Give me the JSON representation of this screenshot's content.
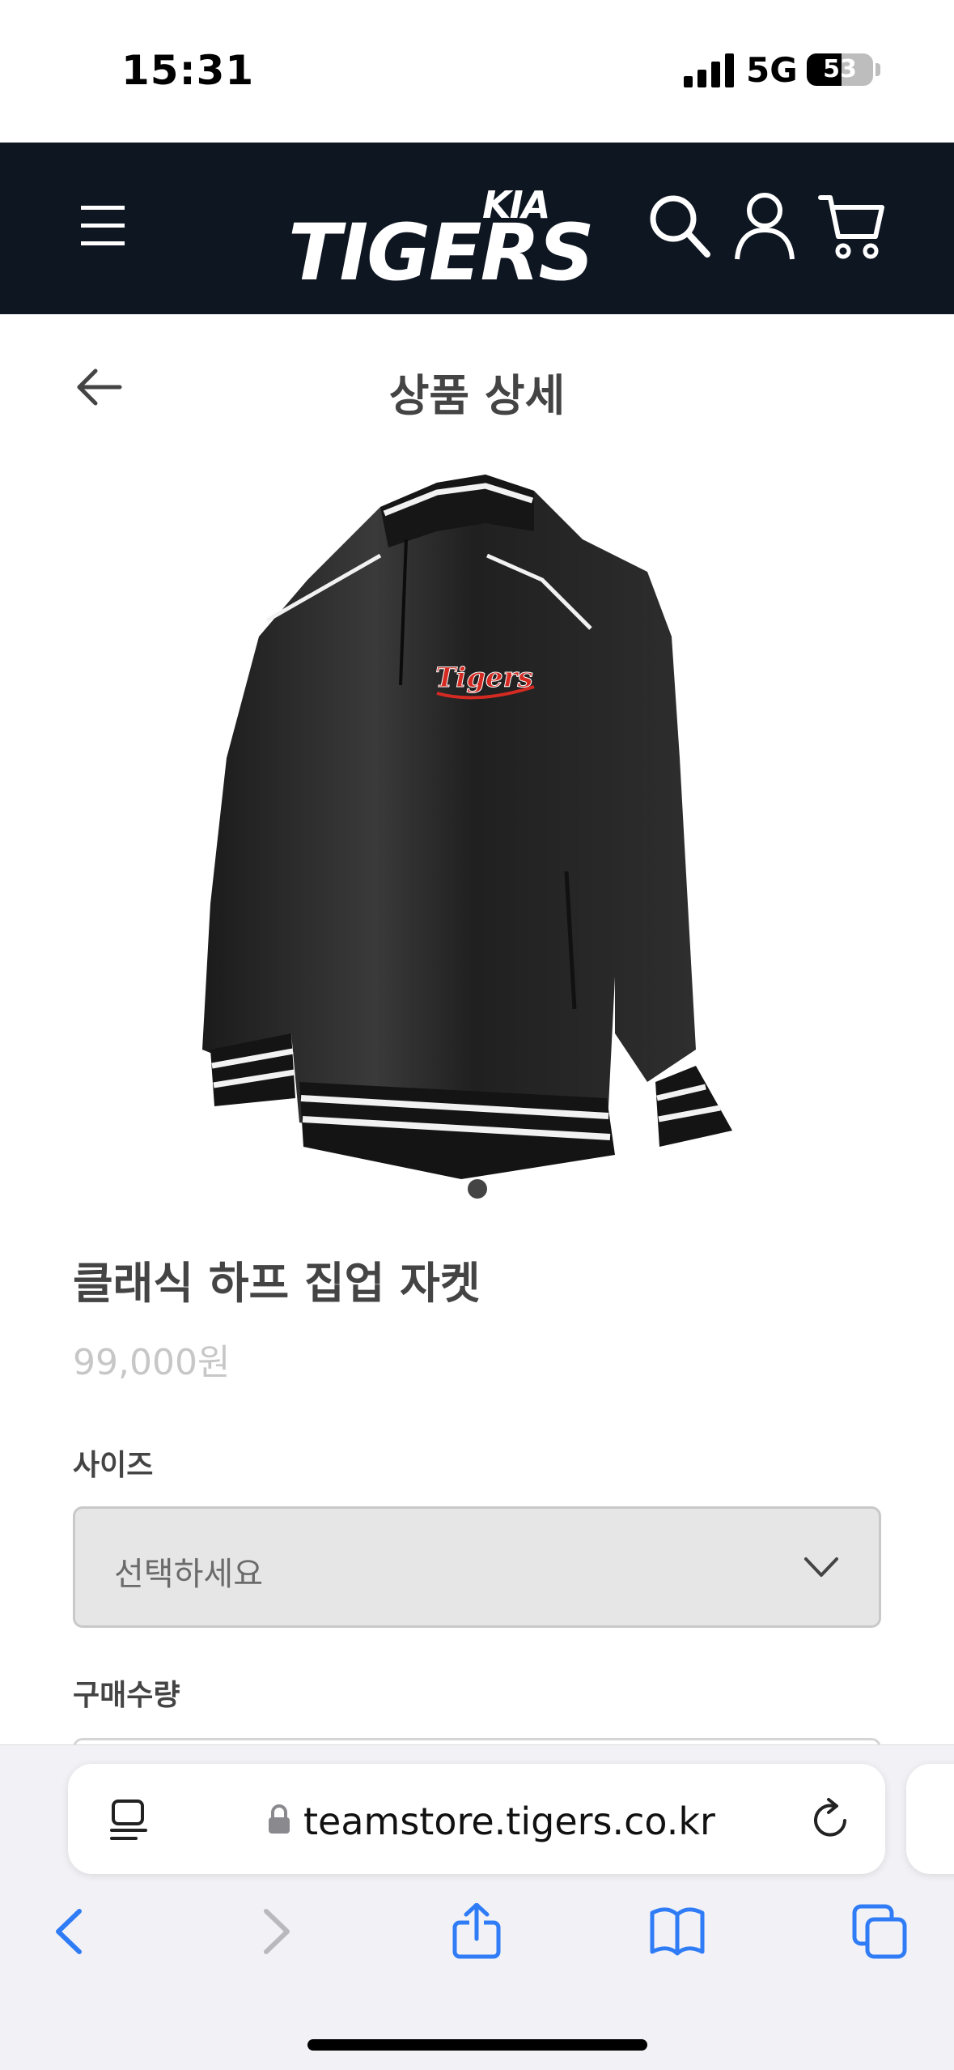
{
  "status_bar": {
    "time": "15:31",
    "network": "5G",
    "battery": "53",
    "battery_level_percent": 53
  },
  "header": {
    "brand_top": "KIA",
    "brand_name": "TIGERS",
    "icons": [
      "menu-icon",
      "search-icon",
      "user-icon",
      "cart-icon"
    ],
    "background_color": "#0e1622"
  },
  "page": {
    "title": "상품 상세"
  },
  "product": {
    "name": "클래식 하프 집업 자켓",
    "price": "99,000원",
    "image_logo_text": "Tigers",
    "image_count": 1
  },
  "options": {
    "size_label": "사이즈",
    "size_value": "선택하세요",
    "quantity_label": "구매수량"
  },
  "browser": {
    "url": "teamstore.tigers.co.kr",
    "toolbar_icons": [
      "back-icon",
      "forward-icon",
      "share-icon",
      "bookmarks-icon",
      "tabs-icon"
    ],
    "accent_color": "#2f7cf6"
  }
}
